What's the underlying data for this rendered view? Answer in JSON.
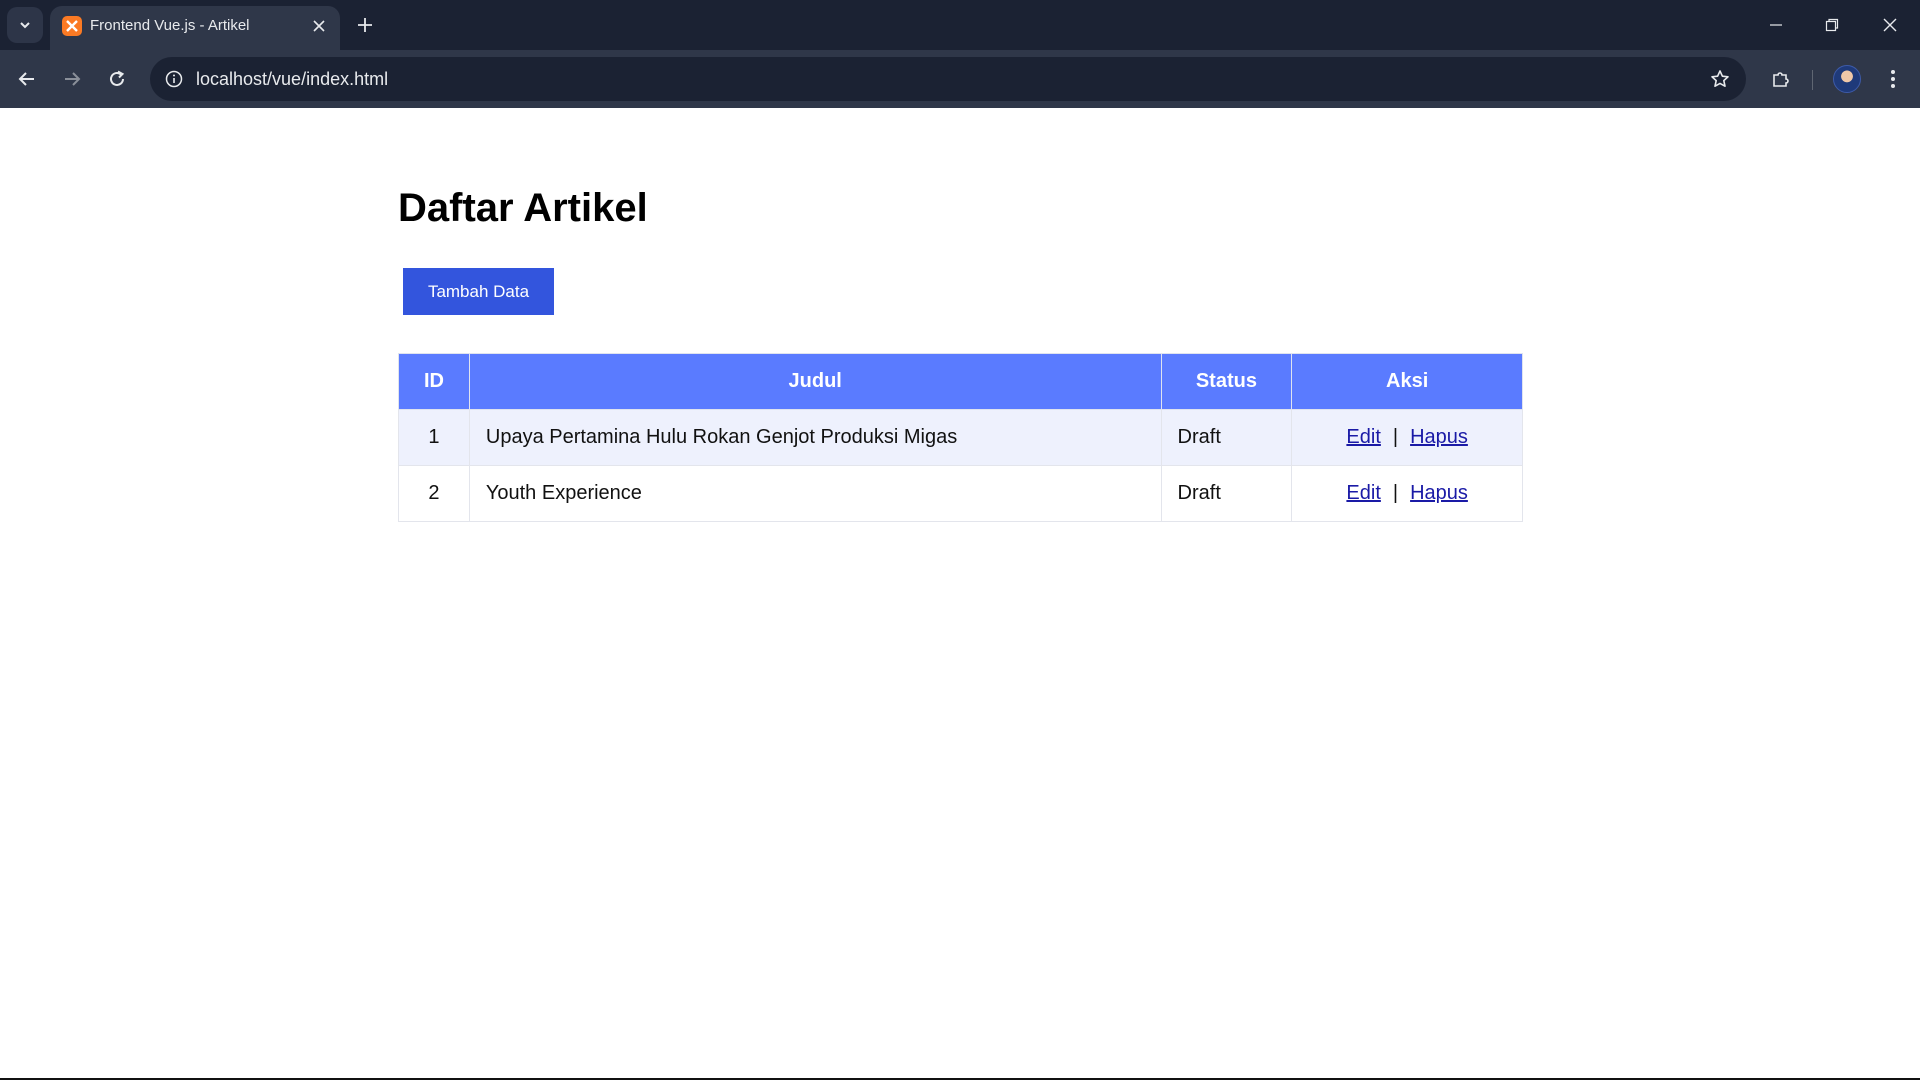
{
  "browser": {
    "tab_title": "Frontend Vue.js - Artikel",
    "url": "localhost/vue/index.html"
  },
  "page": {
    "title": "Daftar Artikel",
    "add_button_label": "Tambah Data",
    "table": {
      "headers": {
        "id": "ID",
        "judul": "Judul",
        "status": "Status",
        "aksi": "Aksi"
      },
      "rows": [
        {
          "id": "1",
          "judul": "Upaya Pertamina Hulu Rokan Genjot Produksi Migas",
          "status": "Draft",
          "edit": "Edit",
          "separator": "|",
          "hapus": "Hapus"
        },
        {
          "id": "2",
          "judul": "Youth Experience",
          "status": "Draft",
          "edit": "Edit",
          "separator": "|",
          "hapus": "Hapus"
        }
      ]
    }
  },
  "colors": {
    "primary_button": "#3355dd",
    "table_header": "#5a7bff",
    "row_stripe": "#eef1fd",
    "link": "#1a1aa6"
  }
}
